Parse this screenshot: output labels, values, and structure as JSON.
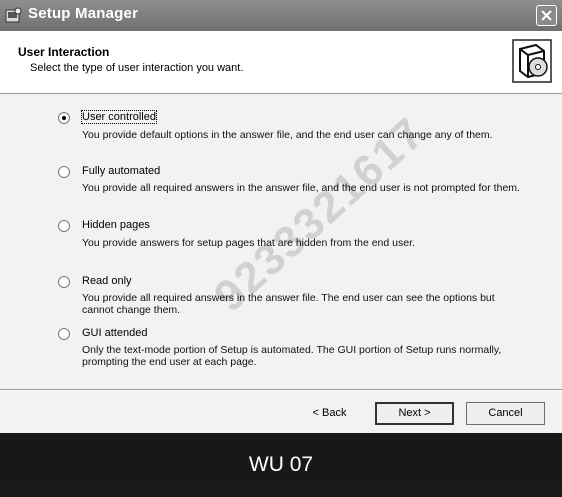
{
  "window": {
    "title": "Setup Manager",
    "app_icon": "setup-manager-icon",
    "close_icon": "close-icon"
  },
  "header": {
    "title": "User Interaction",
    "subtitle": "Select the type of user interaction you want.",
    "icon": "computer-disc-icon"
  },
  "options": [
    {
      "label": "User controlled",
      "description": "You provide default options in the answer file, and the end user can change any of them.",
      "selected": true
    },
    {
      "label": "Fully automated",
      "description": "You provide all required answers in the answer file, and the end user is not prompted for them.",
      "selected": false
    },
    {
      "label": "Hidden pages",
      "description": "You provide answers for setup pages that are hidden from  the end user.",
      "selected": false
    },
    {
      "label": "Read only",
      "description": "You provide all required answers in the answer file. The end user can see the options but cannot change them.",
      "selected": false
    },
    {
      "label": "GUI attended",
      "description": "Only the text-mode portion of Setup is automated. The GUI portion of Setup runs normally, prompting the end user at each page.",
      "selected": false
    }
  ],
  "buttons": {
    "back": "< Back",
    "next": "Next >",
    "cancel": "Cancel"
  },
  "caption": "WU  07",
  "watermark": "9233321617"
}
